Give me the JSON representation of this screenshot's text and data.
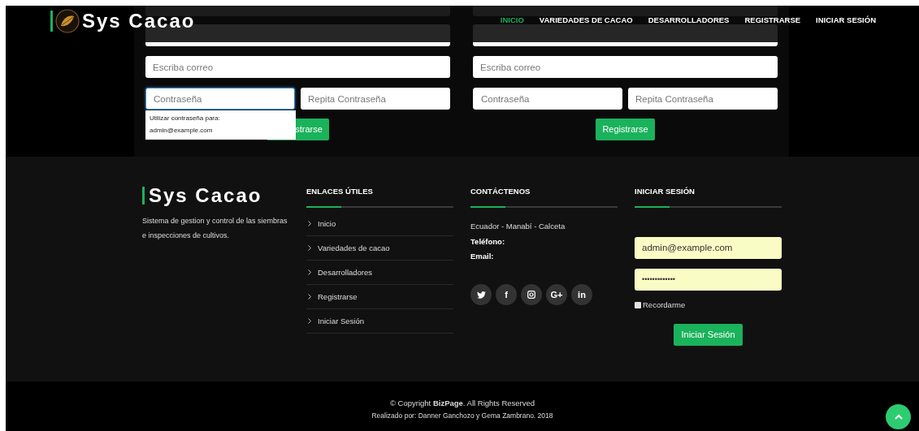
{
  "header": {
    "logo": "Sys Cacao",
    "nav": [
      {
        "label": "INICIO",
        "selected": true
      },
      {
        "label": "VARIEDADES DE CACAO",
        "selected": false
      },
      {
        "label": "DESARROLLADORES",
        "selected": false
      },
      {
        "label": "REGISTRARSE",
        "selected": false
      },
      {
        "label": "INICIAR SESIÓN",
        "selected": false
      }
    ]
  },
  "forms": [
    {
      "email_placeholder": "Escriba correo",
      "password_placeholder": "Contraseña",
      "repeat_placeholder": "Repita Contraseña",
      "password_focused": true,
      "button": "strarse"
    },
    {
      "email_placeholder": "Escriba correo",
      "password_placeholder": "Contraseña",
      "repeat_placeholder": "Repita Contraseña",
      "password_focused": false,
      "button": "Registrarse"
    }
  ],
  "autocomplete": {
    "title": "Utilizar contraseña para:",
    "options": [
      "admin@example.com"
    ]
  },
  "footer": {
    "brand": "Sys Cacao",
    "description": "Sistema de gestion y control de las siembras e inspecciones de cultivos.",
    "links_title": "ENLACES ÚTILES",
    "links": [
      "Inicio",
      "Variedades de cacao",
      "Desarrolladores",
      "Registrarse",
      "Iniciar Sesión"
    ],
    "contact_title": "CONTÁCTENOS",
    "address": "Ecuador - Manabí - Calceta",
    "phone_label": "Teléfono:",
    "email_label": "Email:",
    "social": [
      {
        "kind": "twitter"
      },
      {
        "kind": "text",
        "glyph": "f"
      },
      {
        "kind": "instagram"
      },
      {
        "kind": "text",
        "glyph": "G+"
      },
      {
        "kind": "text",
        "glyph": "in"
      }
    ],
    "login_title": "INICIAR SESIÓN",
    "login_email": "admin@example.com",
    "login_password": "•••••••••••••",
    "remember": {
      "label": "Recordarme",
      "checked": false
    },
    "login_button": "Iniciar Sesión"
  },
  "bottom": {
    "copyright": "© Copyright **BizPage**. All Rights Reserved",
    "credits": "Realizado por: Danner Ganchozo y Gema Zambrano. 2018"
  }
}
